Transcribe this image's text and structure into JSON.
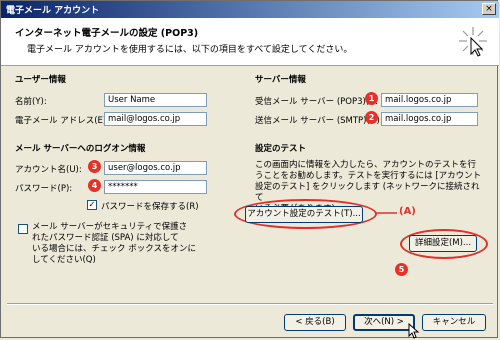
{
  "window": {
    "title": "電子メール アカウント",
    "close_glyph": "×"
  },
  "header": {
    "title": "インターネット電子メールの設定 (POP3)",
    "subtitle": "電子メール アカウントを使用するには、以下の項目をすべて設定してください。",
    "icon": "wizard-sparkle-icon"
  },
  "user_info": {
    "heading": "ユーザー情報",
    "name_label": "名前(Y):",
    "name_value": "User Name",
    "email_label": "電子メール アドレス(E):",
    "email_value": "mail@logos.co.jp"
  },
  "server_info": {
    "heading": "サーバー情報",
    "incoming_label": "受信メール サーバー (POP3)(I):",
    "incoming_value": "mail.logos.co.jp",
    "outgoing_label": "送信メール サーバー (SMTP)(O):",
    "outgoing_value": "mail.logos.co.jp"
  },
  "logon_info": {
    "heading": "メール サーバーへのログオン情報",
    "account_label": "アカウント名(U):",
    "account_value": "user@logos.co.jp",
    "password_label": "パスワード(P):",
    "password_value": "*******",
    "remember_label": "パスワードを保存する(R)",
    "remember_checked": true,
    "spa_label_1": "メール サーバーがセキュリティで保護さ",
    "spa_label_2": "れたパスワード認証 (SPA) に対応して",
    "spa_label_3": "いる場合には、チェック ボックスをオンに",
    "spa_label_4": "してください(Q)",
    "spa_checked": false
  },
  "test": {
    "heading": "設定のテスト",
    "desc_1": "この画面内に情報を入力したら、アカウントのテストを行",
    "desc_2": "うことをお勧めします。テストを実行するには [アカウント",
    "desc_3": "設定のテスト] をクリックします (ネットワークに接続されて",
    "desc_4": "いる必要があります)。",
    "test_button": "アカウント設定のテスト(T)...",
    "more_button": "詳細設定(M)..."
  },
  "footer": {
    "back_button": "< 戻る(B)",
    "next_button": "次へ(N) >",
    "cancel_button": "キャンセル"
  },
  "annotations": {
    "m1": "1",
    "m2": "2",
    "m3": "3",
    "m4": "4",
    "m5": "5",
    "label_a": "(A)",
    "color": "#e0302a"
  }
}
